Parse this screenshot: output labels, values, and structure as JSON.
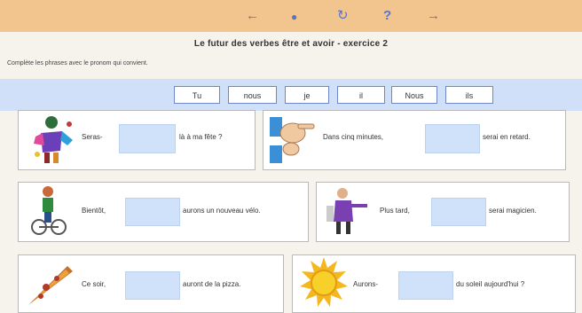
{
  "nav": {
    "back_icon": "left-arrow",
    "home_icon": "home",
    "reload_icon": "refresh",
    "help_icon": "question-mark",
    "forward_icon": "right-arrow"
  },
  "title": "Le futur des verbes être et avoir - exercice 2",
  "instruction": "Complète les phrases avec le pronom qui convient.",
  "word_bank": [
    "Tu",
    "nous",
    "je",
    "il",
    "Nous",
    "ils"
  ],
  "sentences": [
    {
      "before": "Seras-",
      "after": "là à ma fête ?",
      "picture": "party-kid"
    },
    {
      "before": "Dans cinq minutes,",
      "after": "serai en retard.",
      "picture": "pointing-hand"
    },
    {
      "before": "Bientôt,",
      "after": "aurons un nouveau vélo.",
      "picture": "cyclist"
    },
    {
      "before": "Plus tard,",
      "after": "serai magicien.",
      "picture": "magician"
    },
    {
      "before": "Ce soir,",
      "after": "auront de la pizza.",
      "picture": "pizza-slice"
    },
    {
      "before": "Aurons-",
      "after": "du soleil aujourd'hui ?",
      "picture": "sun"
    }
  ],
  "colors": {
    "topbar": "#f2c48e",
    "band": "#cfe0f8",
    "blank": "#cfe2f9",
    "nav": "#5a74c8"
  }
}
